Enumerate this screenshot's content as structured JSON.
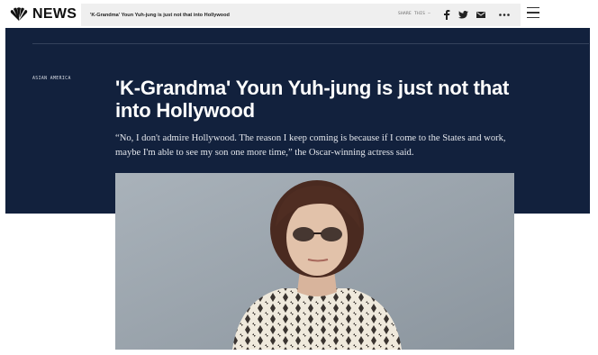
{
  "brand": {
    "name": "NEWS",
    "logo_icon": "peacock-icon"
  },
  "topbar": {
    "article_title": "'K-Grandma' Youn Yuh-jung is just not that into Hollywood",
    "share_label": "SHARE THIS —",
    "share_buttons": [
      {
        "icon": "facebook-icon",
        "glyph": "f"
      },
      {
        "icon": "twitter-icon"
      },
      {
        "icon": "email-icon"
      },
      {
        "icon": "more-icon",
        "glyph": "•••"
      }
    ],
    "menu_icon": "hamburger-icon"
  },
  "article": {
    "kicker": "ASIAN AMERICA",
    "title": "'K-Grandma' Youn Yuh-jung is just not that into Hollywood",
    "dek": "“No, I don't admire Hollywood. The reason I keep coming is because if I come to the States and work, maybe I'm able to see my son one more time,” the Oscar-winning actress said."
  },
  "colors": {
    "hero_bg": "#12213d",
    "strip_bg": "#efefef"
  }
}
